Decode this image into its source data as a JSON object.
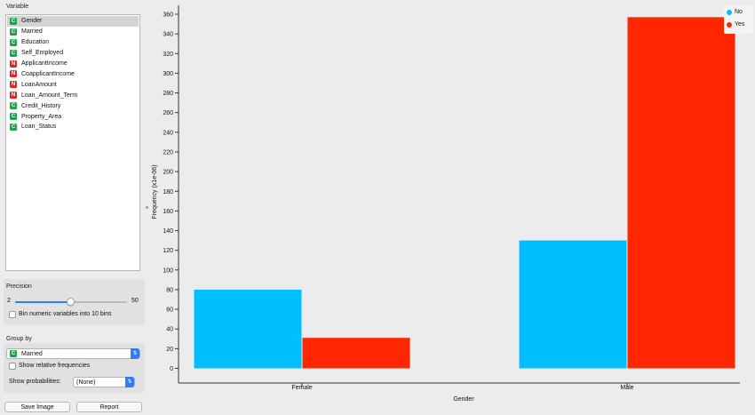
{
  "sidebar": {
    "variable_label": "Variable",
    "variables": [
      {
        "type": "C",
        "name": "Gender",
        "selected": true
      },
      {
        "type": "C",
        "name": "Married",
        "selected": false
      },
      {
        "type": "C",
        "name": "Education",
        "selected": false
      },
      {
        "type": "C",
        "name": "Self_Employed",
        "selected": false
      },
      {
        "type": "N",
        "name": "ApplicantIncome",
        "selected": false
      },
      {
        "type": "N",
        "name": "CoapplicantIncome",
        "selected": false
      },
      {
        "type": "N",
        "name": "LoanAmount",
        "selected": false
      },
      {
        "type": "N",
        "name": "Loan_Amount_Term",
        "selected": false
      },
      {
        "type": "C",
        "name": "Credit_History",
        "selected": false
      },
      {
        "type": "C",
        "name": "Property_Area",
        "selected": false
      },
      {
        "type": "C",
        "name": "Loan_Status",
        "selected": false
      }
    ],
    "precision": {
      "label": "Precision",
      "min_label": "2",
      "max_label": "50",
      "slider_fraction": 0.5,
      "bin_checkbox_label": "Bin numeric variables into 10 bins",
      "bin_checked": false
    },
    "group_by": {
      "label": "Group by",
      "badge": "C",
      "selected": "Married",
      "relative_checkbox_label": "Show relative frequencies",
      "relative_checked": false,
      "probabilities_label": "Show probabilities:",
      "probabilities_value": "(None)"
    },
    "buttons": {
      "save": "Save Image",
      "report": "Report"
    }
  },
  "legend": [
    {
      "name": "No",
      "color": "#00bfff"
    },
    {
      "name": "Yes",
      "color": "#ff2600"
    }
  ],
  "chart_data": {
    "type": "bar",
    "categories": [
      "Female",
      "Male"
    ],
    "series": [
      {
        "name": "No",
        "values": [
          80,
          130
        ],
        "color": "#00bfff"
      },
      {
        "name": "Yes",
        "values": [
          31,
          357
        ],
        "color": "#ff2600"
      }
    ],
    "xlabel": "Gender",
    "ylabel": "Frequency (x1e-06)",
    "ylim": [
      0,
      360
    ],
    "yticks": [
      0,
      20,
      40,
      60,
      80,
      100,
      120,
      140,
      160,
      180,
      200,
      220,
      240,
      260,
      280,
      300,
      320,
      340,
      360
    ],
    "legend_position": "top-right",
    "grid": false
  }
}
